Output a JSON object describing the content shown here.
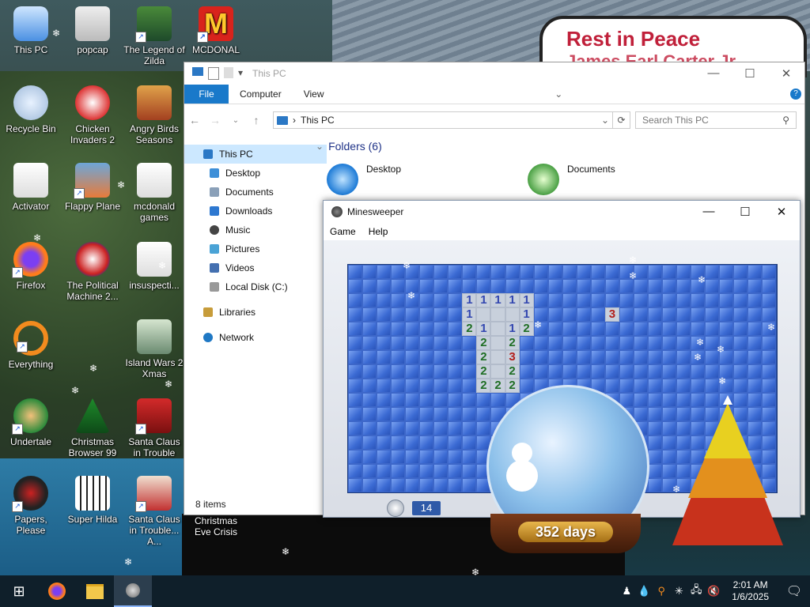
{
  "wallpaper": {
    "sign_line1": "Rest in Peace",
    "sign_line2": "James Earl Carter Jr."
  },
  "desktop_icons": [
    {
      "label": "This PC"
    },
    {
      "label": "popcap"
    },
    {
      "label": "The Legend of Zilda"
    },
    {
      "label": "MCDONAL"
    },
    {
      "label": "Recycle Bin"
    },
    {
      "label": "Chicken Invaders 2"
    },
    {
      "label": "Angry Birds Seasons"
    },
    {
      "label": "Activator"
    },
    {
      "label": "Flappy Plane"
    },
    {
      "label": "mcdonald games"
    },
    {
      "label": "Firefox"
    },
    {
      "label": "The Political Machine 2..."
    },
    {
      "label": "insuspecti..."
    },
    {
      "label": "Everything"
    },
    {
      "label": "Island Wars 2 Xmas"
    },
    {
      "label": "Undertale"
    },
    {
      "label": "Christmas Browser 99"
    },
    {
      "label": "Santa Claus in Trouble"
    },
    {
      "label": "Papers, Please"
    },
    {
      "label": "Super Hilda"
    },
    {
      "label": "Santa Claus in Trouble... A..."
    },
    {
      "label": "Christmas Eve Crisis"
    }
  ],
  "explorer": {
    "title": "This PC",
    "ribbon": {
      "file": "File",
      "computer": "Computer",
      "view": "View"
    },
    "address": "This PC",
    "search_placeholder": "Search This PC",
    "sidebar": [
      {
        "label": "This PC",
        "color": "#2b78c5"
      },
      {
        "label": "Desktop",
        "color": "#3d8fd8"
      },
      {
        "label": "Documents",
        "color": "#8aa0b8"
      },
      {
        "label": "Downloads",
        "color": "#2d78d0"
      },
      {
        "label": "Music",
        "color": "#444"
      },
      {
        "label": "Pictures",
        "color": "#4aa3d6"
      },
      {
        "label": "Videos",
        "color": "#4470b0"
      },
      {
        "label": "Local Disk (C:)",
        "color": "#999"
      },
      {
        "label": "Libraries",
        "color": "#c79c3a"
      },
      {
        "label": "Network",
        "color": "#1f78c4"
      }
    ],
    "folders_header": "Folders (6)",
    "folders": [
      {
        "label": "Desktop"
      },
      {
        "label": "Documents"
      }
    ],
    "status": "8 items"
  },
  "minesweeper": {
    "title": "Minesweeper",
    "menu": {
      "game": "Game",
      "help": "Help"
    },
    "timer": "14",
    "days_badge": "352 days"
  },
  "taskbar": {
    "time": "2:01 AM",
    "date": "1/6/2025"
  }
}
